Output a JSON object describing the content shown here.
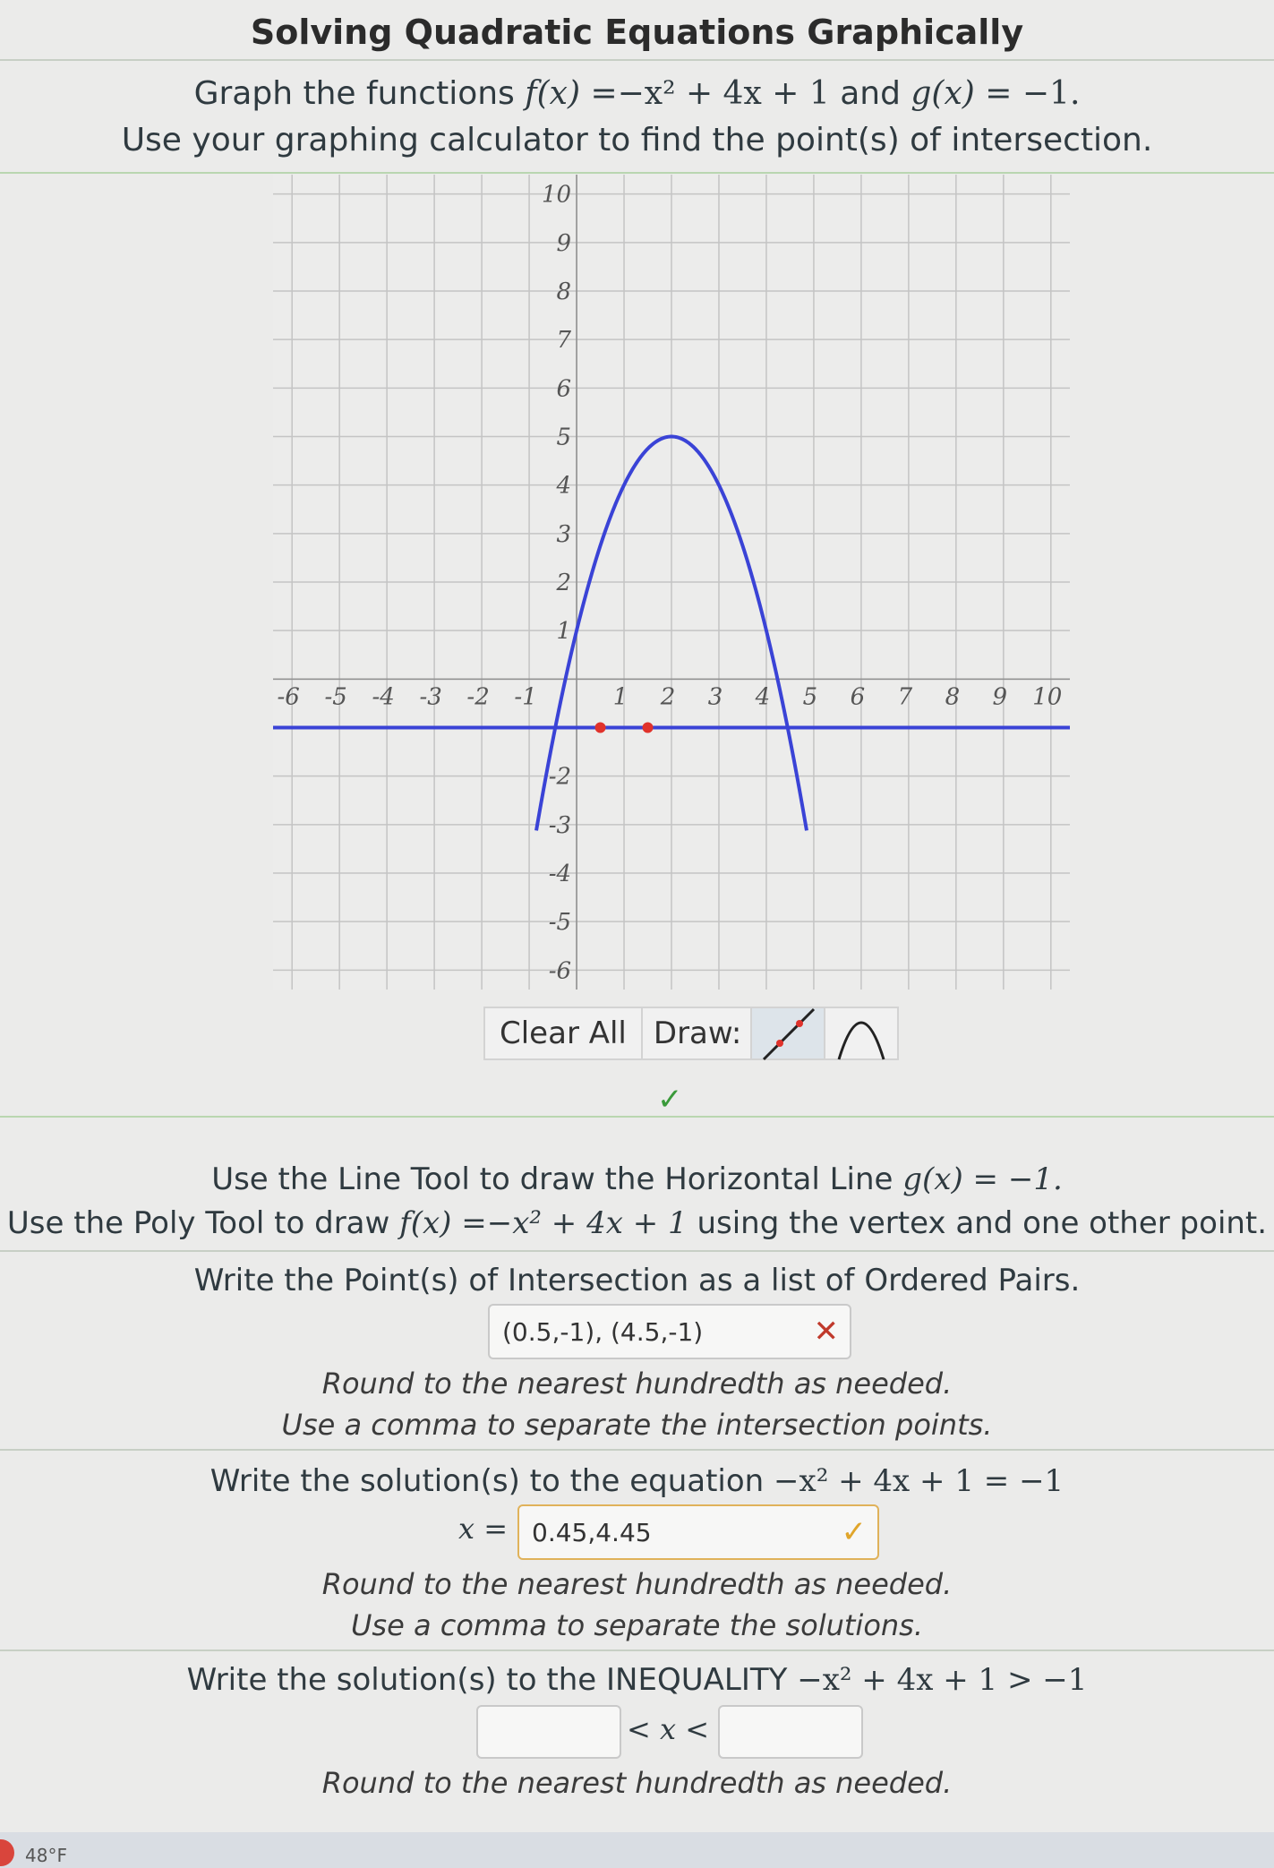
{
  "title": "Solving Quadratic Equations Graphically",
  "instructions": {
    "line1_prefix": "Graph the functions",
    "f_label": "f(x) =",
    "f_expr": "−x² + 4x + 1",
    "and": "and",
    "g_label": "g(x) =",
    "g_expr": "−1.",
    "line2": "Use your graphing calculator to find the point(s) of intersection."
  },
  "chart_data": {
    "type": "line",
    "xlim": [
      -6.4,
      10.4
    ],
    "ylim": [
      -6.4,
      10.4
    ],
    "x_tick_labels": [
      "-6",
      "-5",
      "-4",
      "-3",
      "-2",
      "-1",
      "1",
      "2",
      "3",
      "4",
      "5",
      "6",
      "7",
      "8",
      "9",
      "10"
    ],
    "y_tick_labels": [
      "10",
      "9",
      "8",
      "7",
      "6",
      "5",
      "4",
      "3",
      "2",
      "1",
      "-2",
      "-3",
      "-4",
      "-5",
      "-6"
    ],
    "series": [
      {
        "function": "-x^2+4x+1",
        "color": "#3a43d6"
      },
      {
        "function": "-1",
        "color": "#3a43d6"
      }
    ],
    "points": [
      {
        "x": 0.5,
        "y": -1,
        "color": "#e0322b"
      },
      {
        "x": 1.5,
        "y": -1,
        "color": "#e0322b"
      }
    ]
  },
  "toolbar": {
    "clear_all": "Clear All",
    "draw_label": "Draw:",
    "line_tool_icon": "line-tool-icon",
    "poly_tool_icon": "parabola-tool-icon"
  },
  "status": {
    "graph_check": "✓"
  },
  "directions": {
    "line_tool_a": "Use the Line Tool to draw the Horizontal Line",
    "line_tool_b": "g(x) = −1.",
    "poly_tool_a": "Use the Poly Tool to draw",
    "poly_tool_b": "f(x) =−x² + 4x + 1",
    "poly_tool_c": "using the vertex and one other point."
  },
  "q1": {
    "prompt": "Write the Point(s) of Intersection as a list of Ordered Pairs.",
    "value": "(0.5,-1), (4.5,-1)",
    "mark": "✕",
    "note1": "Round to the nearest hundredth as needed.",
    "note2": "Use a comma to separate the intersection points."
  },
  "q2": {
    "prompt": "Write the solution(s) to the equation",
    "equation": "−x² + 4x + 1 = −1",
    "var_label": "x =",
    "value": "0.45,4.45",
    "mark": "✓",
    "note1": "Round to the nearest hundredth as needed.",
    "note2": "Use a comma to separate the solutions."
  },
  "q3": {
    "prompt": "Write the solution(s) to the INEQUALITY",
    "inequality": "−x² + 4x + 1 > −1",
    "middle": "< x <",
    "low_value": "",
    "high_value": "",
    "note1": "Round to the nearest hundredth as needed."
  },
  "taskbar": {
    "weather": "48°F"
  }
}
